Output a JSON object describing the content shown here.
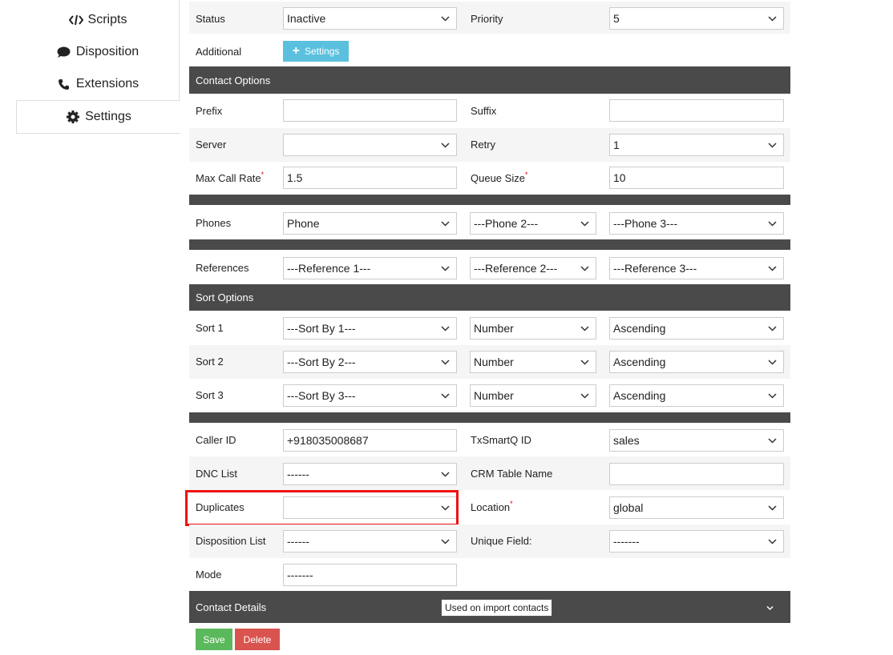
{
  "sidebar": {
    "items": [
      {
        "label": "Scripts",
        "icon": "code-icon"
      },
      {
        "label": "Disposition",
        "icon": "comment-icon"
      },
      {
        "label": "Extensions",
        "icon": "phone-icon"
      },
      {
        "label": "Settings",
        "icon": "gear-icon",
        "active": true
      }
    ]
  },
  "form": {
    "status": {
      "label": "Status",
      "value": "Inactive"
    },
    "priority": {
      "label": "Priority",
      "value": "5"
    },
    "additional": {
      "label": "Additional",
      "button": "Settings"
    },
    "contact_options": {
      "title": "Contact Options",
      "prefix": {
        "label": "Prefix",
        "value": ""
      },
      "suffix": {
        "label": "Suffix",
        "value": ""
      },
      "server": {
        "label": "Server",
        "value": ""
      },
      "retry": {
        "label": "Retry",
        "value": "1"
      },
      "max_call_rate": {
        "label": "Max Call Rate",
        "value": "1.5",
        "required": "*"
      },
      "queue_size": {
        "label": "Queue Size",
        "value": "10",
        "required": "*"
      }
    },
    "phones": {
      "label": "Phones",
      "values": [
        "Phone",
        "---Phone 2---",
        "---Phone 3---"
      ]
    },
    "references": {
      "label": "References",
      "values": [
        "---Reference 1---",
        "---Reference 2---",
        "---Reference 3---"
      ]
    },
    "sort_options": {
      "title": "Sort Options",
      "rows": [
        {
          "label": "Sort 1",
          "by": "---Sort By 1---",
          "type": "Number",
          "order": "Ascending"
        },
        {
          "label": "Sort 2",
          "by": "---Sort By 2---",
          "type": "Number",
          "order": "Ascending"
        },
        {
          "label": "Sort 3",
          "by": "---Sort By 3---",
          "type": "Number",
          "order": "Ascending"
        }
      ]
    },
    "caller_id": {
      "label": "Caller ID",
      "value": "+918035008687"
    },
    "txsmartq_id": {
      "label": "TxSmartQ ID",
      "value": "sales"
    },
    "dnc_list": {
      "label": "DNC List",
      "value": "------"
    },
    "crm_table": {
      "label": "CRM Table Name",
      "value": ""
    },
    "duplicates": {
      "label": "Duplicates",
      "value": ""
    },
    "location": {
      "label": "Location",
      "value": "global",
      "required": "*"
    },
    "disposition_list": {
      "label": "Disposition List",
      "value": "------"
    },
    "unique_field": {
      "label": "Unique Field:",
      "value": "-------"
    },
    "mode": {
      "label": "Mode",
      "value": "-------"
    },
    "contact_details": {
      "title": "Contact Details"
    },
    "tooltip": "Used on import contacts",
    "save": "Save",
    "delete": "Delete"
  },
  "colors": {
    "section_bg": "#4a4a4a",
    "info_button": "#5bc0de",
    "save": "#5cb85c",
    "delete": "#d9534f",
    "highlight": "#e11111"
  }
}
